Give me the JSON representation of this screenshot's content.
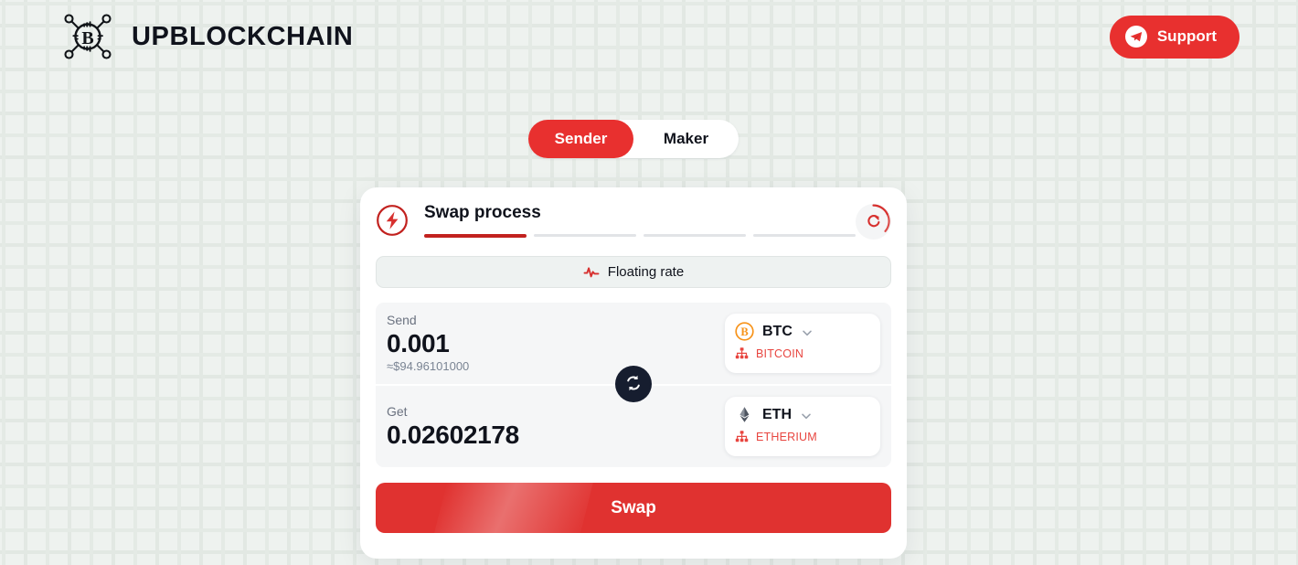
{
  "header": {
    "brand_name": "UPBLOCKCHAIN",
    "logo_icon": "bitcoin-network-logo",
    "support_label": "Support",
    "support_icon": "telegram-icon",
    "accent_color": "#e8302f"
  },
  "tabs": {
    "items": [
      {
        "label": "Sender",
        "active": true
      },
      {
        "label": "Maker",
        "active": false
      }
    ]
  },
  "card": {
    "title": "Swap process",
    "title_icon": "lightning-bolt-icon",
    "refresh_icon": "refresh-icon",
    "steps": [
      {
        "state": "done"
      },
      {
        "state": "pending"
      },
      {
        "state": "pending"
      },
      {
        "state": "pending"
      }
    ],
    "rate_mode": {
      "label": "Floating rate",
      "icon": "pulse-activity-icon"
    },
    "send": {
      "label": "Send",
      "amount": "0.001",
      "approx": "≈$94.96101000",
      "coin": {
        "ticker": "BTC",
        "network": "BITCOIN",
        "coin_icon": "bitcoin-coin-icon",
        "network_icon": "sitemap-icon",
        "chevron_icon": "chevron-down-icon",
        "color": "#f7931a"
      }
    },
    "get": {
      "label": "Get",
      "amount": "0.02602178",
      "coin": {
        "ticker": "ETH",
        "network": "ETHERIUM",
        "coin_icon": "ethereum-coin-icon",
        "network_icon": "sitemap-icon",
        "chevron_icon": "chevron-down-icon",
        "color": "#4e5561"
      }
    },
    "swap_toggle_icon": "swap-arrows-icon",
    "submit_label": "Swap"
  }
}
